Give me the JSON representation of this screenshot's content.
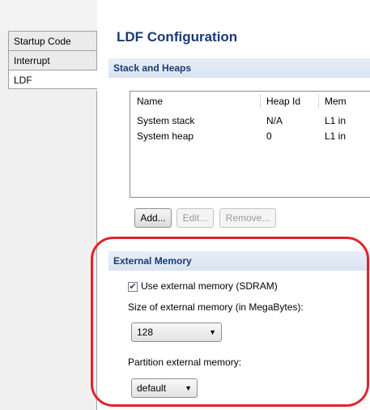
{
  "tabs": [
    {
      "label": "Startup Code",
      "selected": false
    },
    {
      "label": "Interrupt",
      "selected": false
    },
    {
      "label": "LDF",
      "selected": true
    }
  ],
  "page_title": "LDF Configuration",
  "stack_heaps": {
    "header": "Stack and Heaps",
    "columns": [
      "Name",
      "Heap Id",
      "Mem"
    ],
    "rows": [
      [
        "System stack",
        "N/A",
        "L1 in"
      ],
      [
        "System heap",
        "0",
        "L1 in"
      ]
    ],
    "buttons": {
      "add": "Add...",
      "edit": "Edit...",
      "remove": "Remove..."
    }
  },
  "external_memory": {
    "header": "External Memory",
    "use_label": "Use external memory (SDRAM)",
    "use_checked": true,
    "size_label": "Size of external memory (in MegaBytes):",
    "size_value": "128",
    "partition_label": "Partition external memory:",
    "partition_value": "default"
  },
  "icons": {
    "checkmark": "checkmark-icon",
    "dropdown": "dropdown-arrow-icon"
  },
  "colors": {
    "title": "#1a3b73",
    "highlight": "#e0242a"
  }
}
